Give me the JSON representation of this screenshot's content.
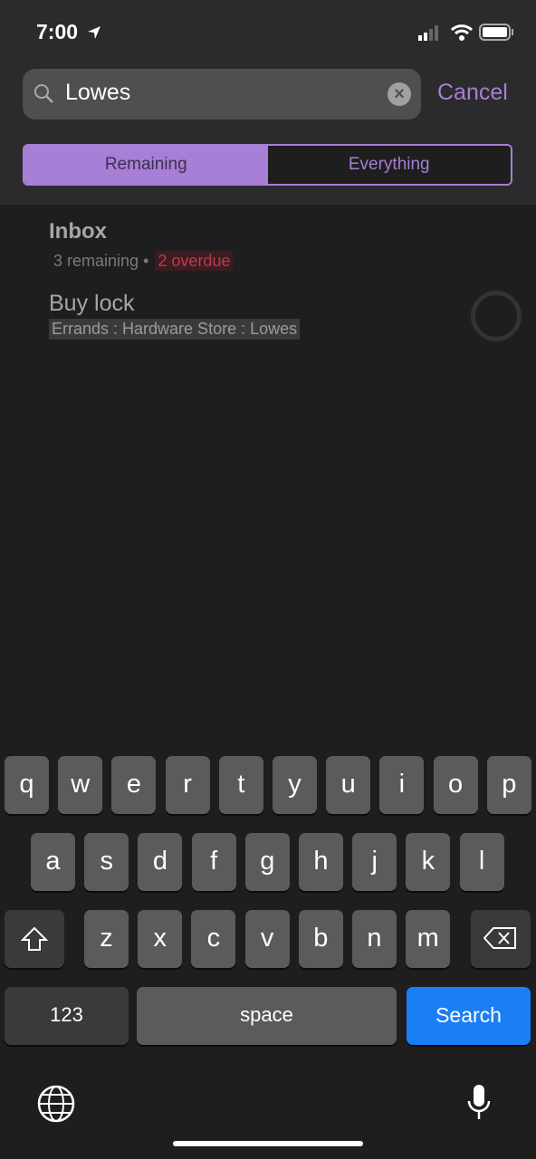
{
  "status_bar": {
    "time": "7:00",
    "icons": [
      "location-arrow-icon",
      "signal-icon",
      "wifi-icon",
      "battery-icon"
    ]
  },
  "search": {
    "value": "Lowes",
    "cancel_label": "Cancel"
  },
  "segments": {
    "remaining": "Remaining",
    "everything": "Everything",
    "selected": "Remaining"
  },
  "colors": {
    "accent": "#a77fd6",
    "overdue": "#c0394b",
    "search_key": "#1a7ef5"
  },
  "results": {
    "project": {
      "title": "Inbox",
      "remaining": "3 remaining",
      "separator": "•",
      "overdue": "2 overdue"
    },
    "task": {
      "title": "Buy lock",
      "path": "Errands : Hardware Store : Lowes"
    }
  },
  "keyboard": {
    "row1": [
      "q",
      "w",
      "e",
      "r",
      "t",
      "y",
      "u",
      "i",
      "o",
      "p"
    ],
    "row2": [
      "a",
      "s",
      "d",
      "f",
      "g",
      "h",
      "j",
      "k",
      "l"
    ],
    "row3": [
      "z",
      "x",
      "c",
      "v",
      "b",
      "n",
      "m"
    ],
    "numbers": "123",
    "space": "space",
    "search": "Search"
  }
}
